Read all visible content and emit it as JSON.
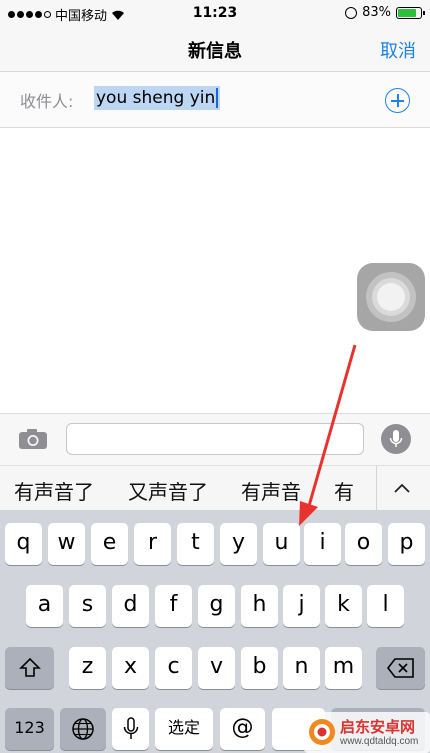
{
  "status_bar": {
    "carrier": "中国移动",
    "time": "11:23",
    "battery": "83%",
    "battery_level": 0.83
  },
  "nav": {
    "title": "新信息",
    "cancel_label": "取消"
  },
  "recipient": {
    "label": "收件人:",
    "value": "you sheng yin"
  },
  "candidates": [
    "有声音了",
    "又声音了",
    "有声音",
    "有"
  ],
  "keyboard": {
    "row1": [
      "q",
      "w",
      "e",
      "r",
      "t",
      "y",
      "u",
      "i",
      "o",
      "p"
    ],
    "row2": [
      "a",
      "s",
      "d",
      "f",
      "g",
      "h",
      "j",
      "k",
      "l"
    ],
    "row3": [
      "z",
      "x",
      "c",
      "v",
      "b",
      "n",
      "m"
    ],
    "row4": {
      "numbers": "123",
      "select": "选定",
      "at": "@"
    }
  },
  "watermark": {
    "title": "启东安卓网",
    "url": "www.qdtaldq.com"
  },
  "colors": {
    "accent": "#1f82e6",
    "arrow": "#e8322b",
    "keyboard_bg": "#d1d4da"
  }
}
